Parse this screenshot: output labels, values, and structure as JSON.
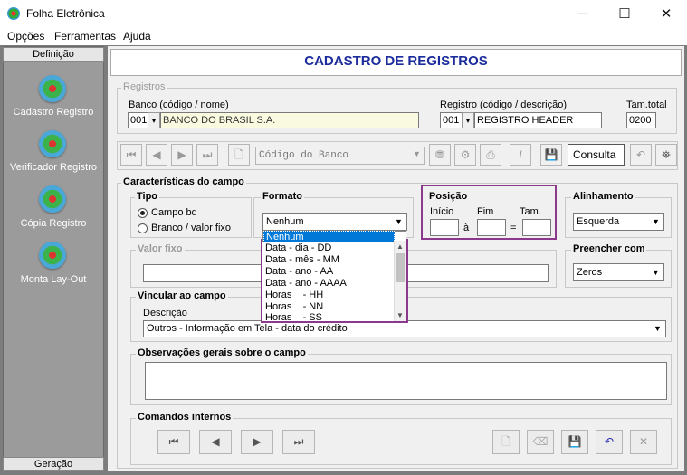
{
  "window": {
    "title": "Folha Eletrônica",
    "minimize": "─",
    "maximize": "☐",
    "close": "✕"
  },
  "menu": [
    "Opções",
    "Ferramentas",
    "Ajuda"
  ],
  "sidebar": {
    "header": "Definição",
    "footer": "Geração",
    "items": [
      {
        "label": "Cadastro Registro"
      },
      {
        "label": "Verificador Registro"
      },
      {
        "label": "Cópia Registro"
      },
      {
        "label": "Monta Lay-Out"
      }
    ]
  },
  "page_title": "CADASTRO DE REGISTROS",
  "registros": {
    "legend": "Registros",
    "banco_label": "Banco (código / nome)",
    "banco_code": "001",
    "banco_name": "BANCO DO BRASIL S.A.",
    "registro_label": "Registro (código / descrição)",
    "registro_code": "001",
    "registro_desc": "REGISTRO HEADER",
    "tam_label": "Tam.total",
    "tam_value": "0200"
  },
  "toolbar": {
    "search_field": "Código do Banco",
    "consulta": "Consulta"
  },
  "caracteristicas": {
    "legend": "Características do campo",
    "tipo": {
      "legend": "Tipo",
      "options": [
        "Campo bd",
        "Branco / valor fixo"
      ]
    },
    "formato": {
      "legend": "Formato",
      "selected": "Nenhum",
      "options": [
        "Nenhum",
        "Data - dia - DD",
        "Data - mês - MM",
        "Data - ano - AA",
        "Data - ano - AAAA",
        "Horas    - HH",
        "Horas    - NN",
        "Horas    - SS"
      ]
    },
    "posicao": {
      "legend": "Posição",
      "inicio": "Início",
      "fim": "Fim",
      "tam": "Tam.",
      "a": "à",
      "eq": "="
    },
    "alinhamento": {
      "legend": "Alinhamento",
      "selected": "Esquerda"
    },
    "valor_fixo": {
      "legend": "Valor fixo"
    },
    "preencher": {
      "legend": "Preencher com",
      "selected": "Zeros"
    },
    "vincular": {
      "legend": "Vincular ao campo",
      "descricao_label": "Descrição",
      "descricao_value": "Outros - Informação em Tela - data do crédito"
    },
    "observacoes": {
      "legend": "Observações gerais sobre o campo"
    },
    "comandos": {
      "legend": "Comandos internos"
    }
  }
}
